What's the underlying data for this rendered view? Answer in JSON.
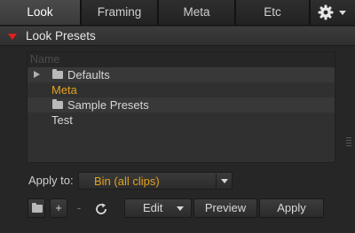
{
  "tabs": [
    {
      "label": "Look",
      "active": true
    },
    {
      "label": "Framing",
      "active": false
    },
    {
      "label": "Meta",
      "active": false
    },
    {
      "label": "Etc",
      "active": false
    }
  ],
  "gear_menu": {
    "icon": "gear-icon"
  },
  "section": {
    "title": "Look Presets",
    "expanded": true
  },
  "list": {
    "header": "Name",
    "rows": [
      {
        "label": "Defaults",
        "type": "folder",
        "expandable": true,
        "selected": false
      },
      {
        "label": "Meta",
        "type": "preset",
        "selected": true
      },
      {
        "label": "Sample Presets",
        "type": "folder",
        "expandable": false,
        "selected": false
      },
      {
        "label": "Test",
        "type": "preset",
        "selected": false
      }
    ]
  },
  "apply_to": {
    "label": "Apply to:",
    "value": "Bin (all clips)"
  },
  "toolbar": {
    "add_label": "+",
    "remove_label": "-",
    "edit_label": "Edit",
    "preview_label": "Preview",
    "apply_label": "Apply"
  },
  "colors": {
    "accent": "#e3a21f",
    "disclosure": "#e0201c",
    "background": "#262626"
  }
}
